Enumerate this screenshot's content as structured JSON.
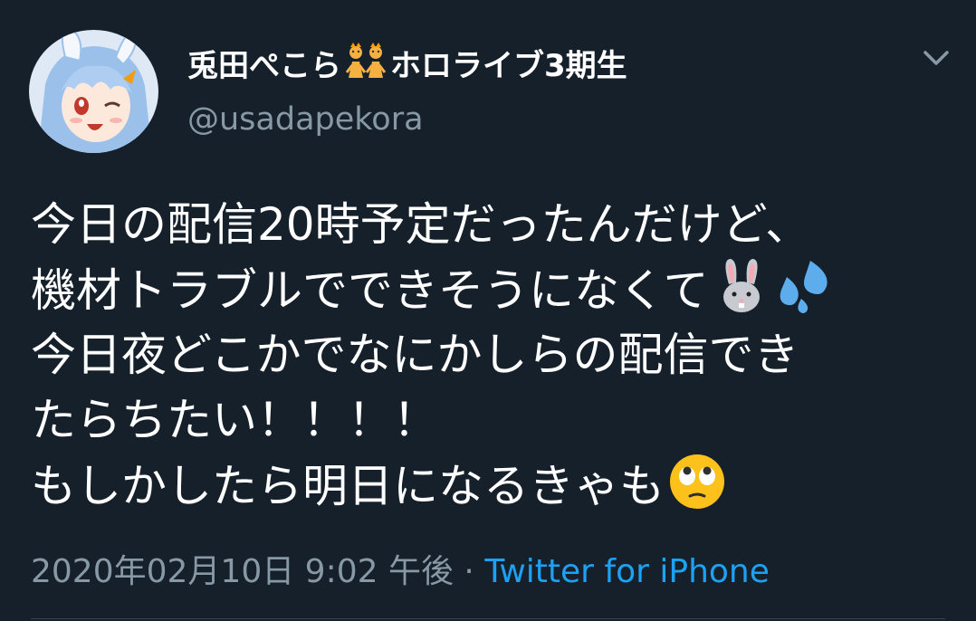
{
  "tweet": {
    "display_name_prefix": "兎田ぺこら",
    "display_name_suffix": "ホロライブ3期生",
    "badge_icon": "kids-badge-icon",
    "handle": "@usadapekora",
    "caret_icon": "chevron-down-icon",
    "body_lines": [
      "今日の配信20時予定だったんだけど、",
      "機材トラブルでできそうになくて",
      "今日夜どこかでなにかしらの配信でき",
      "たらちたい！！！！",
      "もしかしたら明日になるきゃも"
    ],
    "line2_emojis": [
      "rabbit-face-emoji",
      "sweat-droplets-emoji"
    ],
    "line5_emoji": "face-with-rolling-eyes-emoji",
    "timestamp": "2020年02月10日 9:02 午後",
    "separator": " · ",
    "source": "Twitter for iPhone"
  },
  "colors": {
    "background": "#15202b",
    "text": "#ffffff",
    "secondary": "#8899a6",
    "link": "#1da1f2"
  }
}
